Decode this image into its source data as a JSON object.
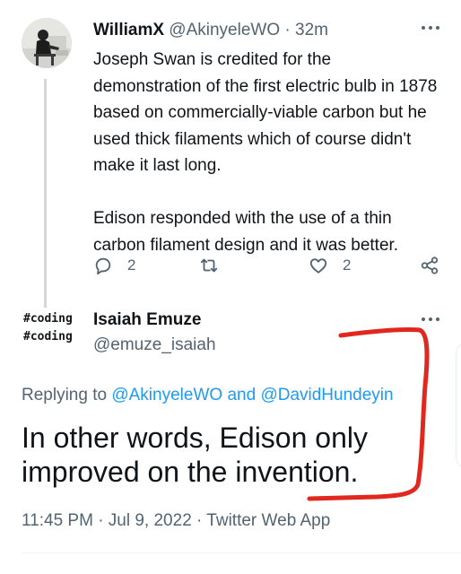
{
  "tweet1": {
    "avatar_icon": "user-photo-avatar",
    "name": "WilliamX",
    "handle": "@AkinyeleWO",
    "separator": "·",
    "time": "32m",
    "paragraphs": [
      "Joseph Swan is credited for the demonstration of the first electric bulb in 1878 based on commercially-viable carbon but he used thick filaments which of course didn't make it last long.",
      "Edison responded with the use of a thin carbon filament design and it was better."
    ],
    "actions": {
      "reply_count": "2",
      "retweet_count": "",
      "like_count": "2"
    }
  },
  "tweet2": {
    "avatar_lines": [
      "#coding",
      "#coding"
    ],
    "name": "Isaiah Emuze",
    "handle": "@emuze_isaiah",
    "replying_prefix": "Replying to",
    "reply_to_1": "@AkinyeleWO",
    "reply_and": "and",
    "reply_to_2": "@DavidHundeyin",
    "text": "In other words, Edison only improved on the invention.",
    "meta": "11:45 PM · Jul 9, 2022 · Twitter Web App"
  },
  "colors": {
    "text": "#0f1419",
    "secondary": "#536471",
    "link": "#1d9bf0",
    "annotation_red": "#e0281f",
    "thread_line": "#cfd9de"
  },
  "icons": [
    "more-icon",
    "reply-icon",
    "retweet-icon",
    "like-icon",
    "share-icon"
  ]
}
